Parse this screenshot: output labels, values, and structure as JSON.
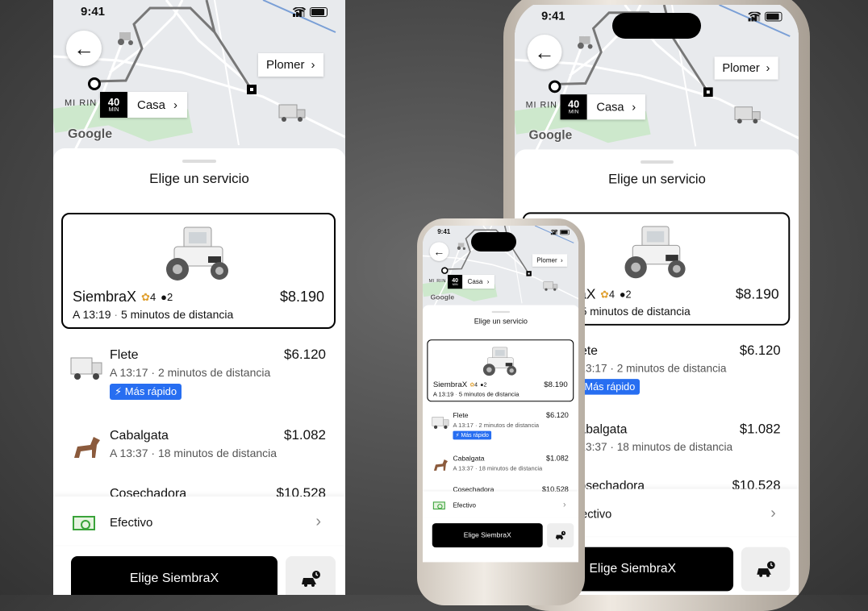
{
  "status": {
    "time": "9:41"
  },
  "map": {
    "destination": "Plomer",
    "origin": "Casa",
    "eta_value": "40",
    "eta_unit": "MIN",
    "area_label": "MI RIN",
    "provider": "Google"
  },
  "sheet": {
    "title": "Elige un servicio",
    "selected": {
      "name": "SiembraX",
      "rating": "4",
      "capacity": "2",
      "price": "$8.190",
      "arrival": "A 13:19",
      "distance": "5 minutos de distancia"
    },
    "options": [
      {
        "name": "Flete",
        "price": "$6.120",
        "arrival": "A 13:17",
        "distance": "2  minutos de distancia",
        "badge": "Más rápido",
        "icon": "delivery-truck-icon"
      },
      {
        "name": "Cabalgata",
        "price": "$1.082",
        "arrival": "A 13:37",
        "distance": "18  minutos de distancia",
        "icon": "horse-icon"
      },
      {
        "name": "Cosechadora",
        "price": "$10.528",
        "icon": "harvester-icon"
      }
    ]
  },
  "payment": {
    "label": "Efectivo"
  },
  "cta": {
    "label": "Elige SiembraX"
  },
  "colors": {
    "accent": "#276ef1",
    "primary": "#000000",
    "cash": "#3aa33a"
  }
}
